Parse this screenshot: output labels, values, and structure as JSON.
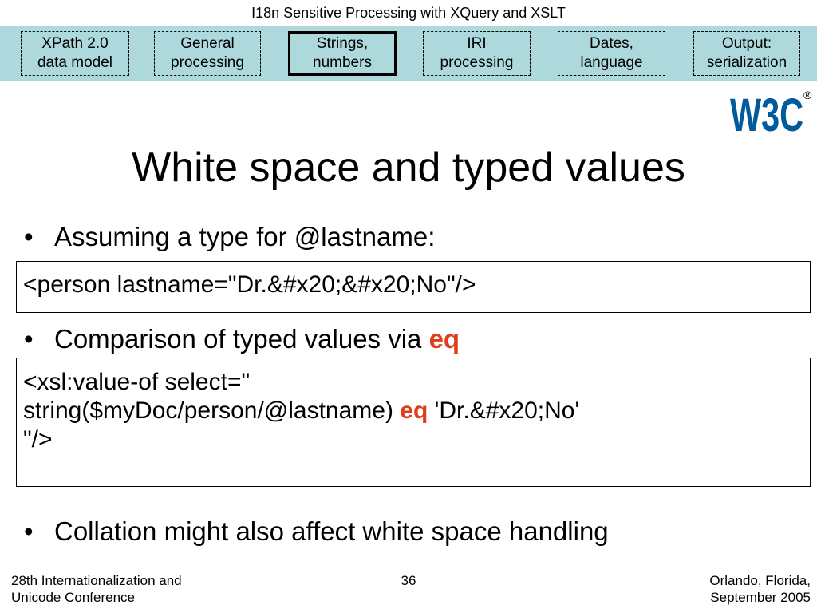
{
  "header": {
    "title": "I18n Sensitive Processing with XQuery and XSLT"
  },
  "nav": {
    "tabs": [
      {
        "line1": "XPath 2.0",
        "line2": "data model"
      },
      {
        "line1": "General",
        "line2": "processing"
      },
      {
        "line1": "Strings,",
        "line2": "numbers",
        "active": true
      },
      {
        "line1": "IRI",
        "line2": "processing"
      },
      {
        "line1": "Dates,",
        "line2": "language"
      },
      {
        "line1": "Output:",
        "line2": "serialization"
      }
    ],
    "background_color": "#add8dc"
  },
  "logo": {
    "text": "W3C",
    "mark": "®",
    "color": "#005a9c"
  },
  "slide": {
    "title": "White space and typed values",
    "bullet1": "Assuming a type for @lastname:",
    "code1": "<person lastname=\"Dr.&#x20;&#x20;No\"/>",
    "bullet2_text": "Comparison of typed values via ",
    "bullet2_kw": "eq",
    "code2_line1": "<xsl:value-of select=\"",
    "code2_line2_pre": "string($myDoc/person/@lastname) ",
    "code2_line2_kw": "eq",
    "code2_line2_post": " 'Dr.&#x20;No'",
    "code2_line3": "\"/>",
    "bullet3": "Collation might also affect white space handling",
    "bullet_glyph": "•",
    "keyword_color": "#e03c1e"
  },
  "footer": {
    "left_line1": "28th Internationalization and",
    "left_line2": "Unicode Conference",
    "page_number": "36",
    "right_line1": "Orlando, Florida,",
    "right_line2": "September 2005"
  }
}
